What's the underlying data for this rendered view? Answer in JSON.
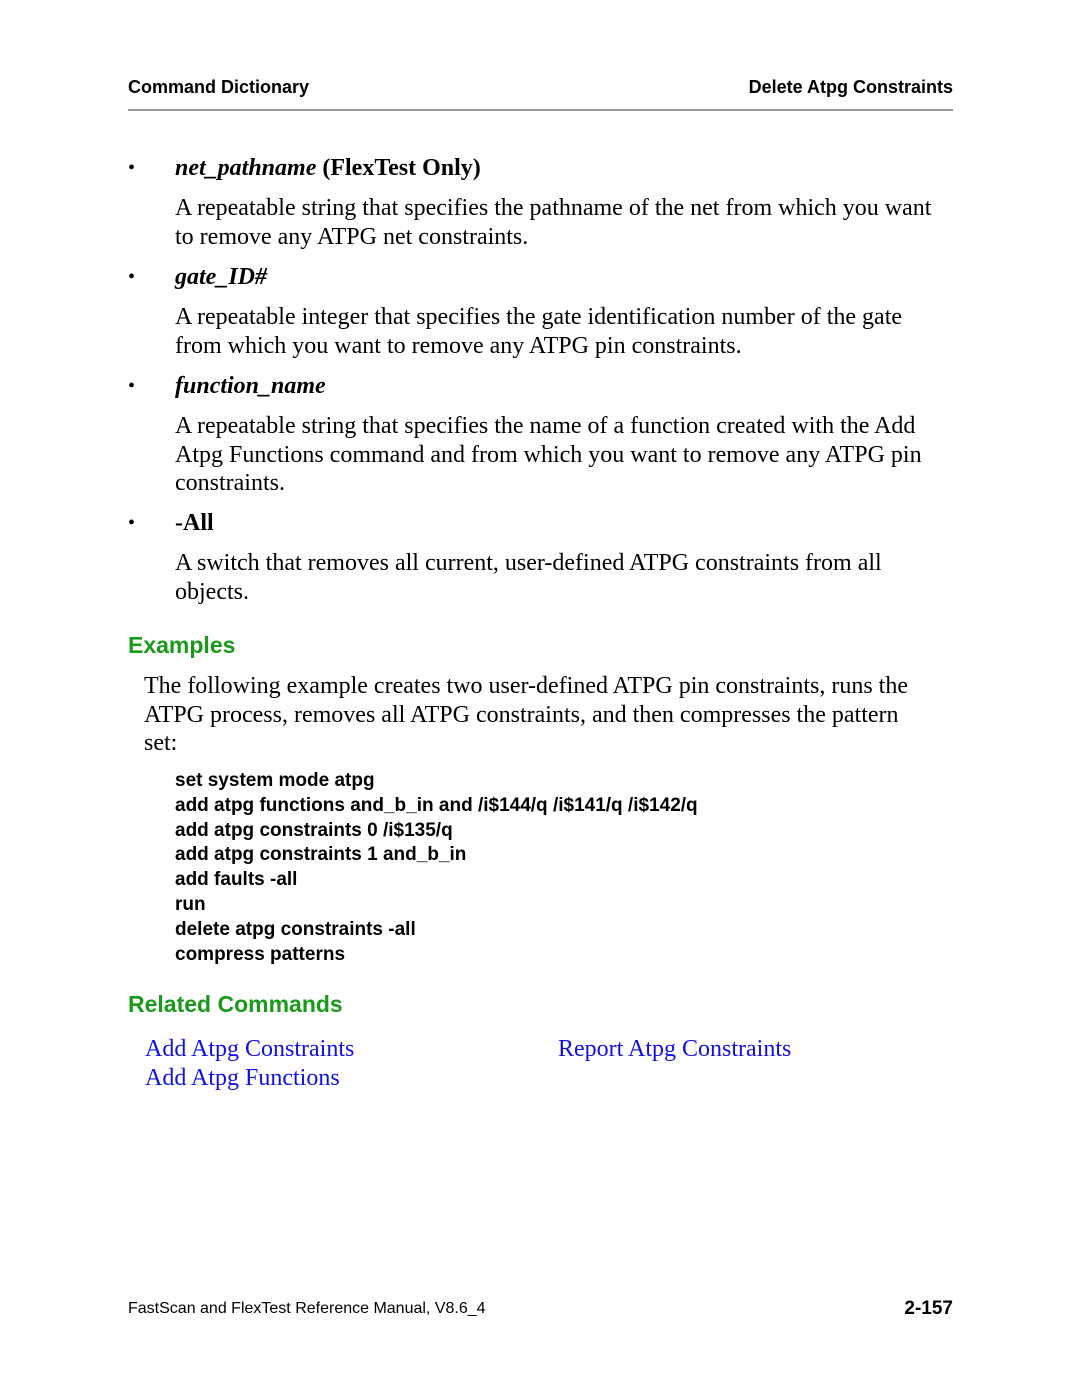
{
  "header": {
    "left": "Command Dictionary",
    "right": "Delete Atpg Constraints"
  },
  "arguments": [
    {
      "name": "net_pathname",
      "qualifier": "(FlexTest Only)",
      "description_lines": [
        "A repeatable string that specifies the pathname of the net from which you want",
        "to remove any ATPG net constraints."
      ]
    },
    {
      "name": "gate_ID#",
      "qualifier": "",
      "description_lines": [
        "A repeatable integer that specifies the gate identification number of the gate",
        "from which you want to remove any ATPG pin constraints."
      ]
    },
    {
      "name": "function_name",
      "qualifier": "",
      "description_lines": [
        "A repeatable string that specifies the name of a function created with the Add",
        "Atpg Functions command and from which you want to remove any ATPG pin",
        "constraints."
      ]
    },
    {
      "name": "-All",
      "qualifier": "",
      "description_lines": [
        "A switch that removes all current, user-defined ATPG constraints from all",
        "objects."
      ]
    }
  ],
  "examples": {
    "heading": "Examples",
    "intro_lines": [
      "The following example creates two user-defined ATPG pin constraints, runs the",
      "ATPG process, removes all ATPG constraints, and then compresses the pattern",
      "set:"
    ],
    "code": [
      "set system mode atpg",
      "add atpg functions and_b_in and /i$144/q /i$141/q /i$142/q",
      "add atpg constraints 0 /i$135/q",
      "add atpg constraints 1 and_b_in",
      "add faults -all",
      "run",
      "delete atpg constraints -all",
      "compress patterns"
    ]
  },
  "related": {
    "heading": "Related Commands",
    "links": [
      "Add Atpg Constraints",
      "Add Atpg Functions",
      "Report Atpg Constraints"
    ],
    "link_color": "#1010e8"
  },
  "footer": {
    "left": "FastScan and FlexTest Reference Manual, V8.6_4",
    "page_number": "2-157"
  },
  "colors": {
    "section_heading": "#1a9a1a",
    "rule": "#9a9a9a"
  }
}
